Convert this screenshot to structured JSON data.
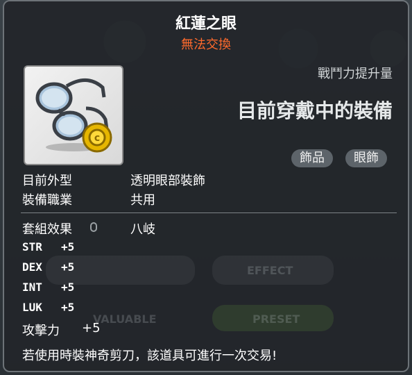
{
  "tooltip": {
    "item_name": "紅蓮之眼",
    "trade_status": "無法交換",
    "power_increase_label": "戰鬥力提升量",
    "equipped_label": "目前穿戴中的裝備",
    "tags": [
      "飾品",
      "眼飾"
    ],
    "appearance_label": "目前外型",
    "appearance_value": "透明眼部裝飾",
    "job_label": "裝備職業",
    "job_value": "共用",
    "set_label": "套組效果",
    "set_value": "八岐",
    "stats": [
      {
        "name": "STR",
        "value": "+5"
      },
      {
        "name": "DEX",
        "value": "+5"
      },
      {
        "name": "INT",
        "value": "+5"
      },
      {
        "name": "LUK",
        "value": "+5"
      }
    ],
    "attack_label": "攻擊力",
    "attack_value": "+5",
    "note": "若使用時裝神奇剪刀，該道具可進行一次交易!"
  },
  "background": {
    "effect_label": "EFFECT",
    "valuable_label": "VALUABLE",
    "preset_label": "PRESET"
  },
  "icons": [
    "glasses-item-icon",
    "lock-icon"
  ],
  "colors": {
    "trade_status": "#ff6a2c",
    "tag_bg": "#5d646a"
  }
}
